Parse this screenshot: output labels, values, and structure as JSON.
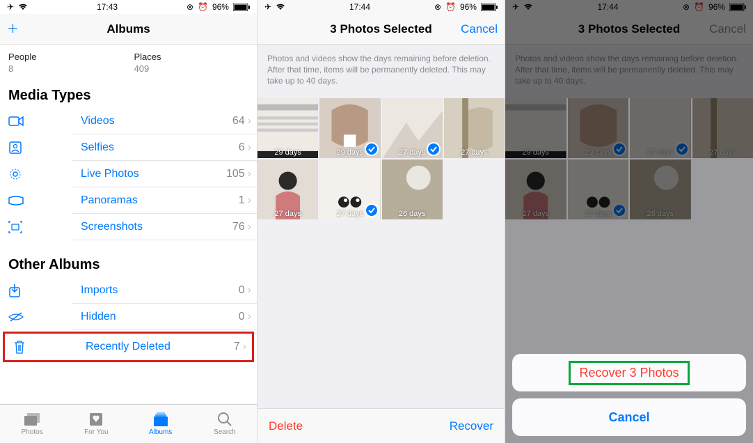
{
  "screen1": {
    "status": {
      "time": "17:43",
      "battery": "96%"
    },
    "nav": {
      "title": "Albums"
    },
    "counts": {
      "people": {
        "label": "People",
        "value": "8"
      },
      "places": {
        "label": "Places",
        "value": "409"
      }
    },
    "mediaTypes": {
      "heading": "Media Types",
      "items": [
        {
          "label": "Videos",
          "count": "64"
        },
        {
          "label": "Selfies",
          "count": "6"
        },
        {
          "label": "Live Photos",
          "count": "105"
        },
        {
          "label": "Panoramas",
          "count": "1"
        },
        {
          "label": "Screenshots",
          "count": "76"
        }
      ]
    },
    "otherAlbums": {
      "heading": "Other Albums",
      "items": [
        {
          "label": "Imports",
          "count": "0"
        },
        {
          "label": "Hidden",
          "count": "0"
        },
        {
          "label": "Recently Deleted",
          "count": "7"
        }
      ]
    },
    "tabs": [
      {
        "label": "Photos"
      },
      {
        "label": "For You"
      },
      {
        "label": "Albums"
      },
      {
        "label": "Search"
      }
    ]
  },
  "screen2": {
    "status": {
      "time": "17:44",
      "battery": "96%"
    },
    "nav": {
      "title": "3 Photos Selected",
      "right": "Cancel"
    },
    "desc": "Photos and videos show the days remaining before deletion. After that time, items will be permanently deleted. This may take up to 40 days.",
    "cells": [
      {
        "days": "29 days",
        "selected": false
      },
      {
        "days": "29 days",
        "selected": true
      },
      {
        "days": "27 days",
        "selected": true
      },
      {
        "days": "27 days",
        "selected": false
      },
      {
        "days": "27 days",
        "selected": false
      },
      {
        "days": "27 days",
        "selected": true
      },
      {
        "days": "26 days",
        "selected": false
      }
    ],
    "bottom": {
      "delete": "Delete",
      "recover": "Recover"
    }
  },
  "screen3": {
    "status": {
      "time": "17:44",
      "battery": "96%"
    },
    "nav": {
      "title": "3 Photos Selected",
      "right": "Cancel"
    },
    "desc": "Photos and videos show the days remaining before deletion. After that time, items will be permanently deleted. This may take up to 40 days.",
    "cells": [
      {
        "days": "29 days",
        "selected": false
      },
      {
        "days": "29 days",
        "selected": true
      },
      {
        "days": "27 days",
        "selected": true
      },
      {
        "days": "27 days",
        "selected": false
      },
      {
        "days": "27 days",
        "selected": false
      },
      {
        "days": "27 days",
        "selected": true
      },
      {
        "days": "26 days",
        "selected": false
      }
    ],
    "sheet": {
      "recover": "Recover 3 Photos",
      "cancel": "Cancel"
    }
  }
}
